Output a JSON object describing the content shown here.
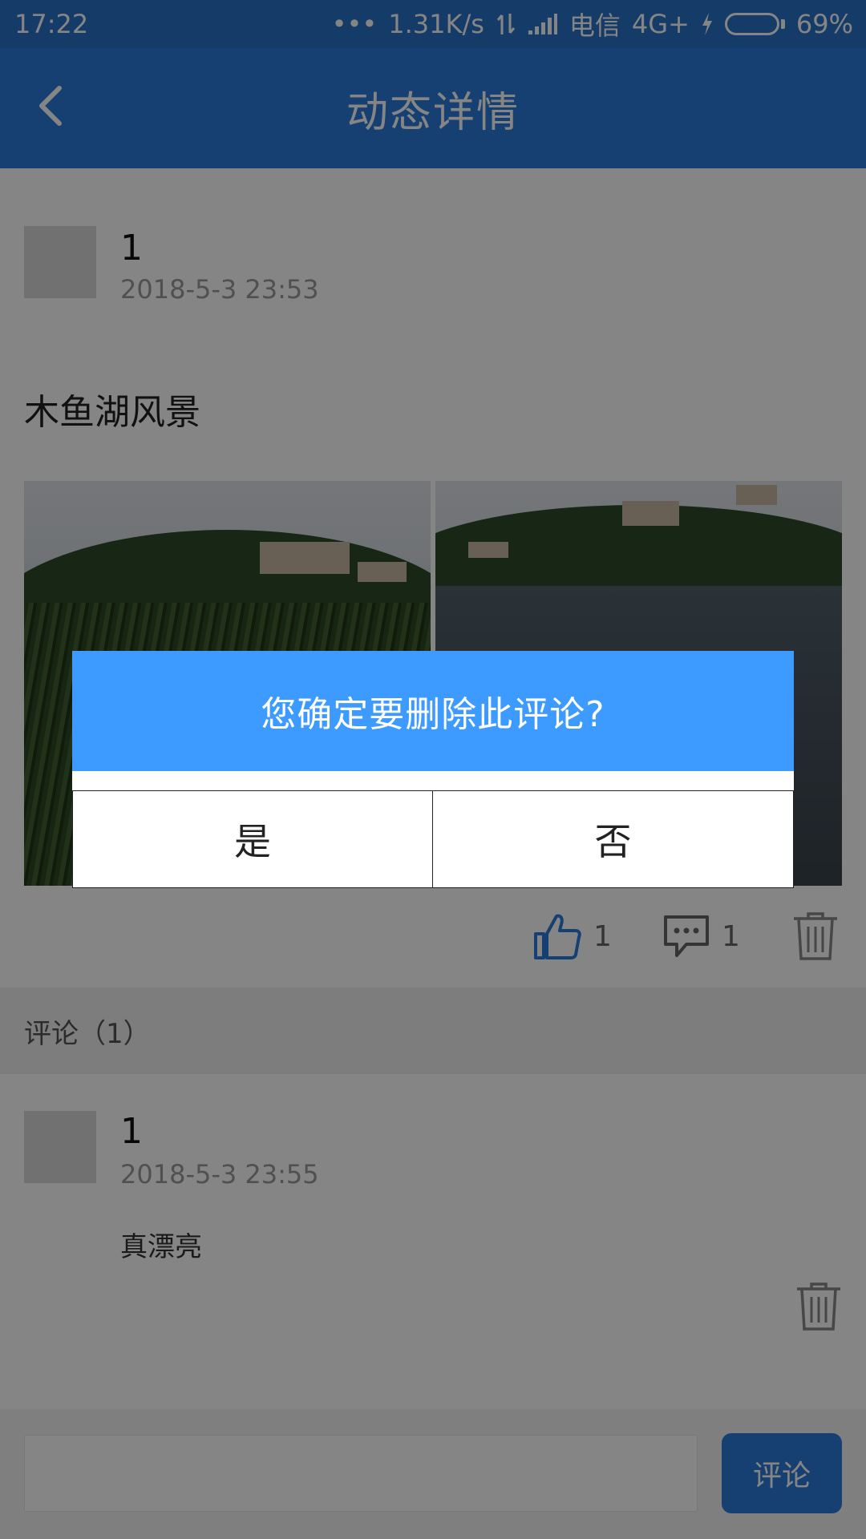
{
  "status_bar": {
    "time": "17:22",
    "dots": "•••",
    "speed": "1.31K/s",
    "carrier": "电信",
    "network": "4G+",
    "battery": "69%"
  },
  "header": {
    "title": "动态详情",
    "back_icon": "chevron-left-icon"
  },
  "post": {
    "author": "1",
    "time": "2018-5-3 23:53",
    "text": "木鱼湖风景",
    "like_count": "1",
    "comment_count": "1"
  },
  "comments_section": {
    "header": "评论（1）",
    "items": [
      {
        "author": "1",
        "time": "2018-5-3 23:55",
        "text": "真漂亮"
      }
    ]
  },
  "bottom_bar": {
    "input_value": "",
    "submit_label": "评论"
  },
  "dialog": {
    "title": "您确定要删除此评论?",
    "yes_label": "是",
    "no_label": "否"
  },
  "colors": {
    "header": "#2b7cd9",
    "dialog_header": "#3d9bff",
    "like_icon": "#2b7cd9"
  }
}
